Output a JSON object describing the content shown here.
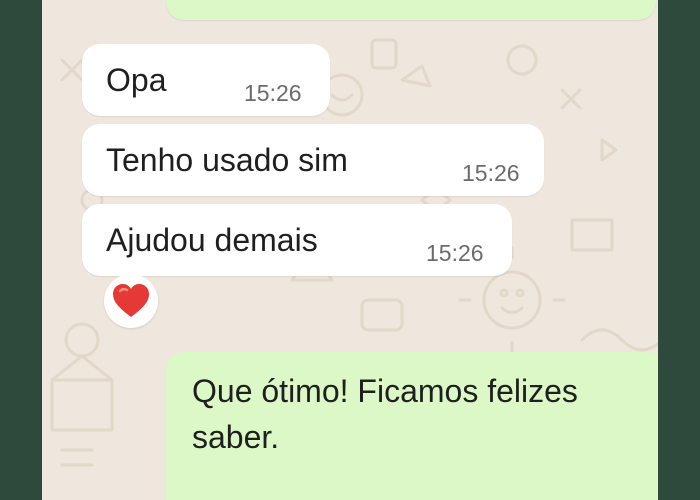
{
  "colors": {
    "chat_background": "#efe7dd",
    "incoming_bubble": "#ffffff",
    "outgoing_bubble": "#dcf8c6",
    "frame": "#2e4a3c",
    "heart": "#e53935"
  },
  "messages": [
    {
      "direction": "incoming",
      "text": "Opa",
      "time": "15:26"
    },
    {
      "direction": "incoming",
      "text": "Tenho usado sim",
      "time": "15:26"
    },
    {
      "direction": "incoming",
      "text": "Ajudou demais",
      "time": "15:26",
      "reaction": "heart-icon"
    },
    {
      "direction": "outgoing",
      "lines": [
        "Que ótimo! Ficamos felizes",
        "saber."
      ]
    }
  ]
}
